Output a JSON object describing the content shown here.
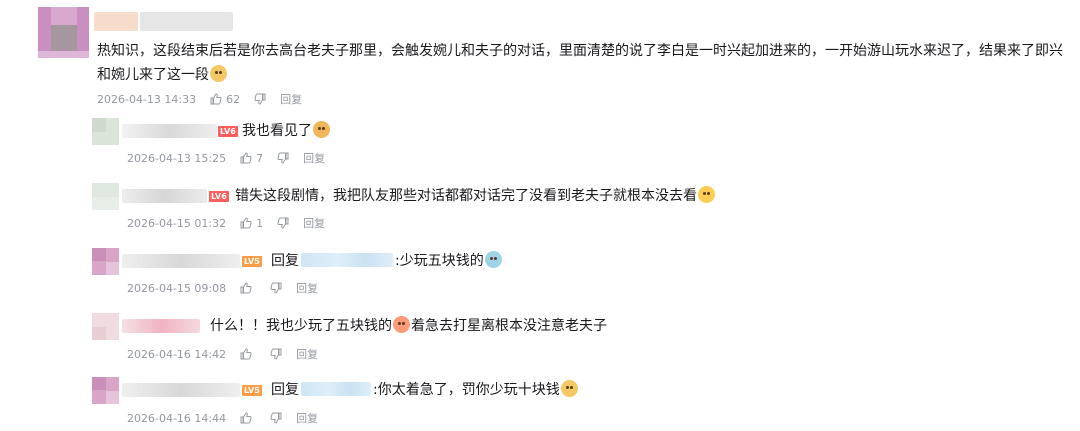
{
  "colors": {
    "text": "#18191c",
    "meta": "#9499a0",
    "level_badge": "#ff6d6d"
  },
  "comments": [
    {
      "text_line1": "热知识，这段结束后若是你去高台老夫子那里，会触发婉儿和夫子的对话，里面清楚的说了李白是一时兴起加进来的，一开始游山玩水来迟了，结果来了即兴",
      "text_line2": "和婉儿来了这一段",
      "date": "2026-04-13 14:33",
      "likes": "62",
      "reply_label": "回复"
    }
  ],
  "replies": [
    {
      "level": "LV6",
      "text": "我也看见了",
      "date": "2026-04-13 15:25",
      "likes": "7",
      "reply_label": "回复"
    },
    {
      "level": "LV6",
      "text": "错失这段剧情，我把队友那些对话都都对话完了没看到老夫子就根本没去看",
      "date": "2026-04-15 01:32",
      "likes": "1",
      "reply_label": "回复"
    },
    {
      "level": "LV5",
      "prefix": "回复",
      "suffix": ":少玩五块钱的",
      "date": "2026-04-15 09:08",
      "likes": "",
      "reply_label": "回复"
    },
    {
      "text_a": "什么！！我也少玩了五块钱的",
      "text_b": "着急去打星离根本没注意老夫子",
      "date": "2026-04-16 14:42",
      "likes": "",
      "reply_label": "回复"
    },
    {
      "level": "LV5",
      "prefix": "回复",
      "suffix": ":你太着急了，罚你少玩十块钱",
      "date": "2026-04-16 14:44",
      "likes": "",
      "reply_label": "回复"
    }
  ]
}
